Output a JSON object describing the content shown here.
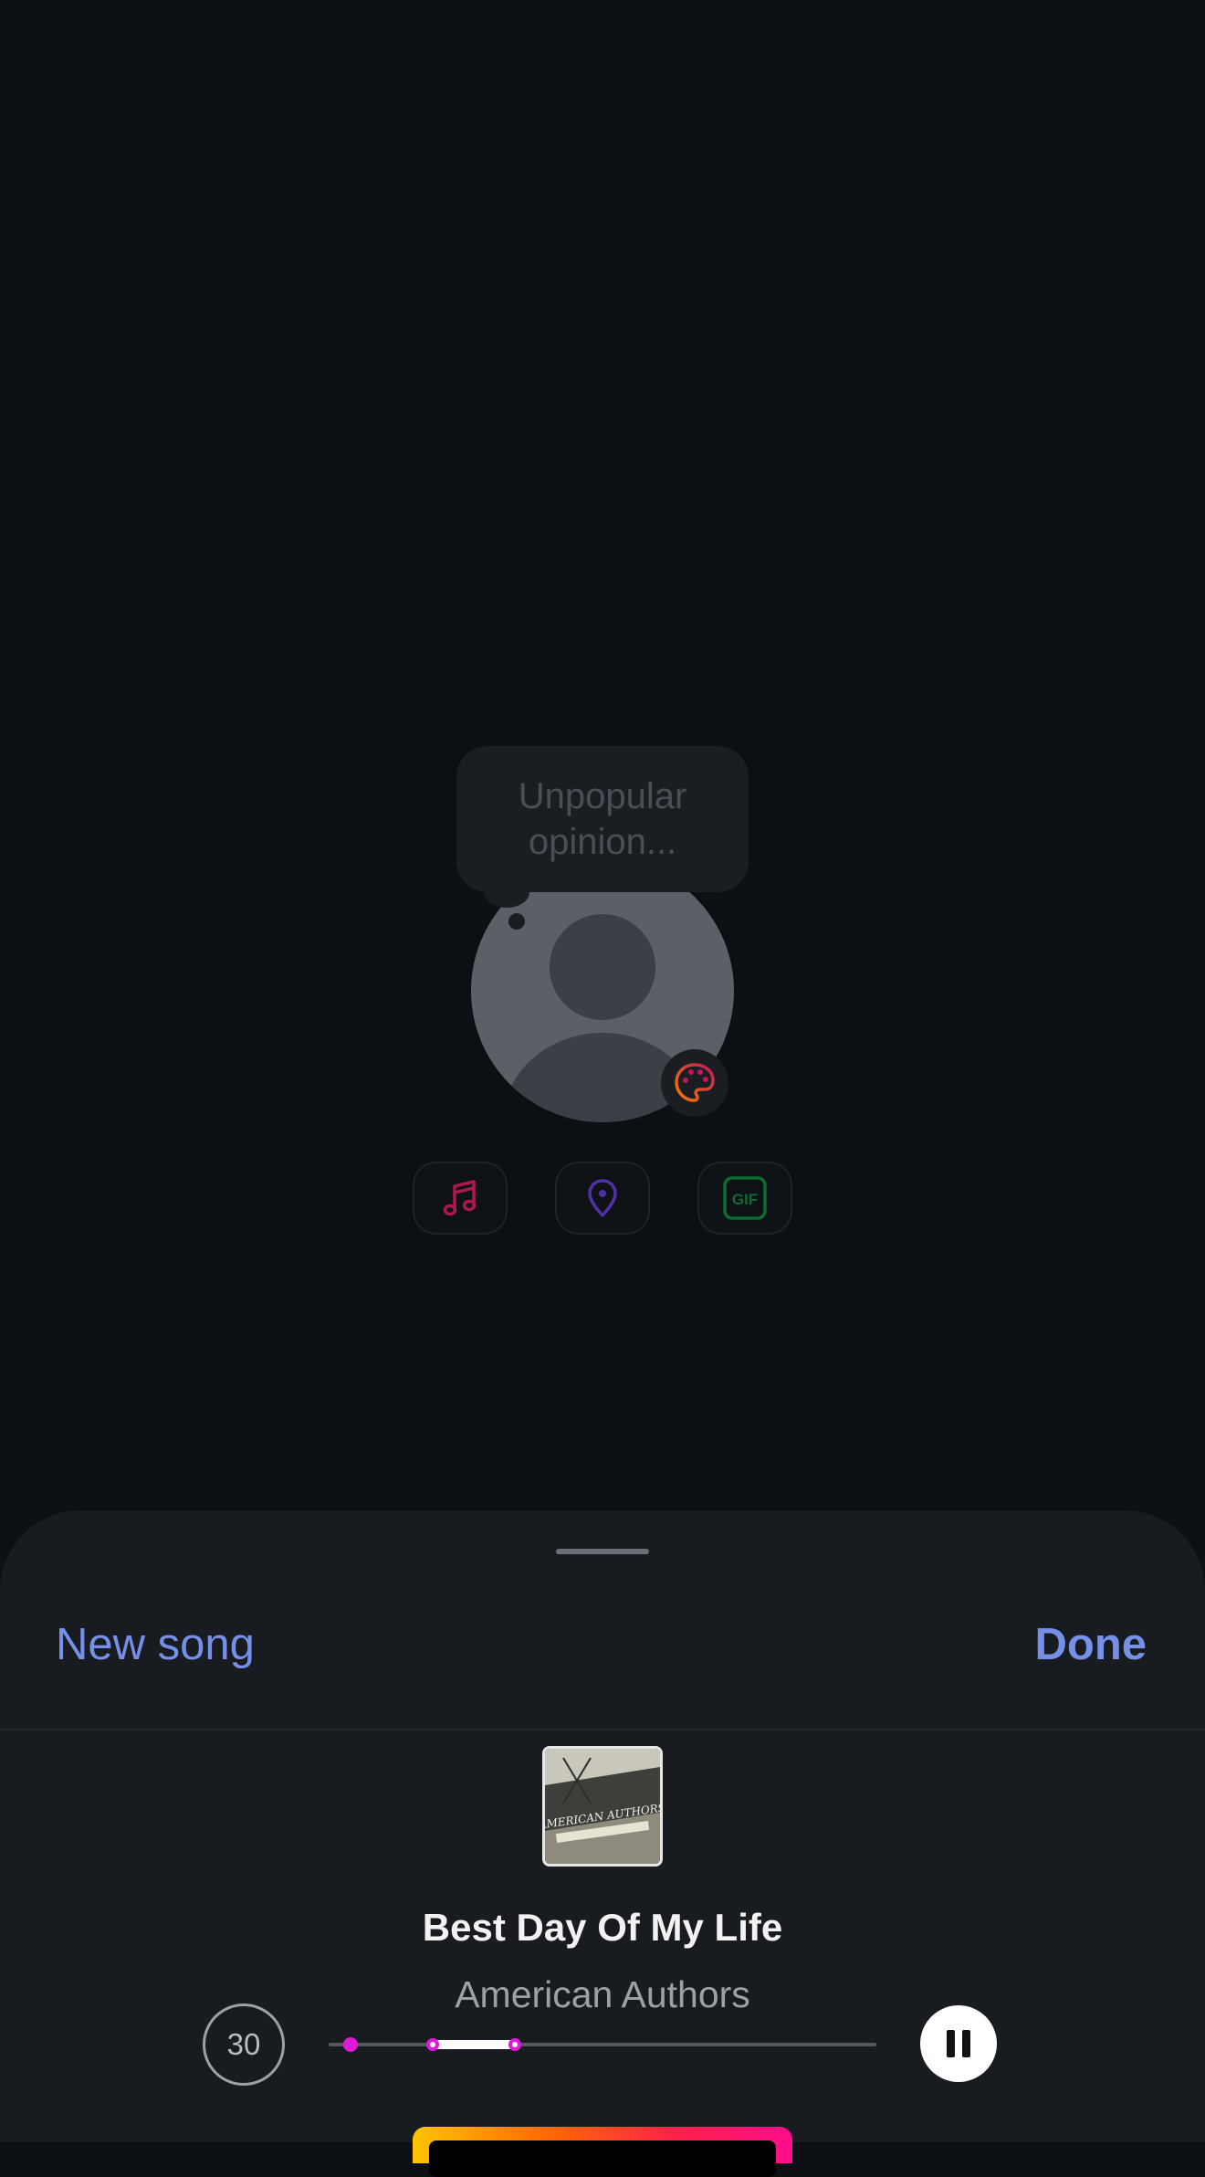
{
  "composer": {
    "note_placeholder": "Unpopular opinion...",
    "icons": {
      "close": "close-icon",
      "palette": "palette-icon",
      "music": "music-note-icon",
      "location": "location-pin-icon",
      "gif": "gif-icon"
    },
    "gif_label": "GIF"
  },
  "music_sheet": {
    "new_song_label": "New song",
    "done_label": "Done",
    "song": {
      "title": "Best Day Of My Life",
      "artist": "American Authors",
      "album_art_text": "AMERICAN AUTHORS"
    },
    "duration_label": "30",
    "scrubber": {
      "start_marker": 0.04,
      "selection_start": 0.19,
      "selection_end": 0.34
    }
  },
  "colors": {
    "accent": "#7590e8",
    "music_icon": "#c2185b",
    "location_icon": "#5e35b1",
    "gif_icon": "#0f8a3f",
    "scrubber_marker": "#e01ad8"
  }
}
